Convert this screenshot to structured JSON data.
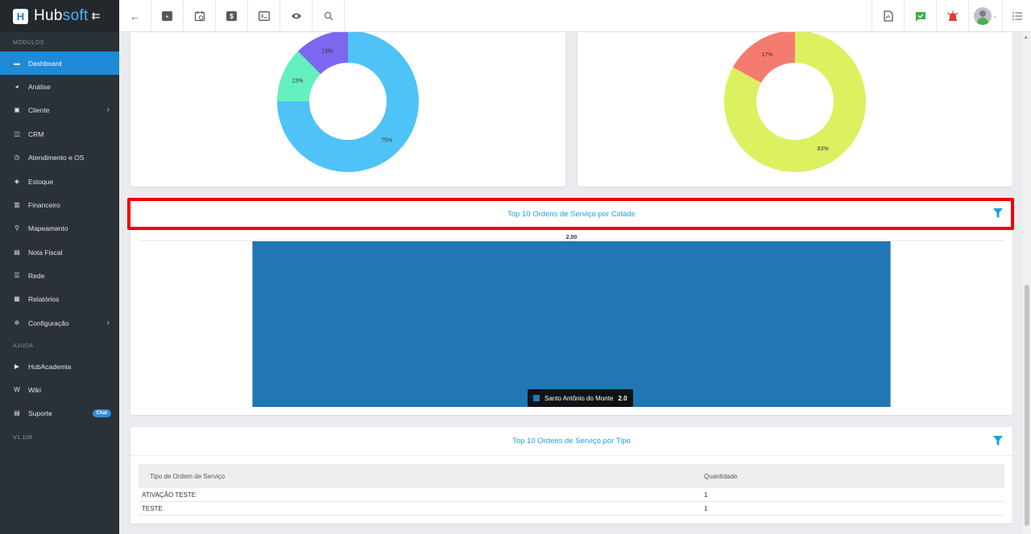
{
  "app": {
    "logo_hub": "Hub",
    "logo_soft": "soft",
    "collapse_icon": "menu-collapse-icon"
  },
  "sidebar": {
    "modules_label": "MÓDULOS",
    "help_label": "AJUDA",
    "version": "V1.108",
    "items": [
      {
        "label": "Dashboard",
        "icon": "dashboard-icon",
        "active": true
      },
      {
        "label": "Análise",
        "icon": "chart-pie-icon"
      },
      {
        "label": "Cliente",
        "icon": "contact-icon",
        "chevron": true
      },
      {
        "label": "CRM",
        "icon": "crm-icon"
      },
      {
        "label": "Atendimento e OS",
        "icon": "calendar-clock-icon"
      },
      {
        "label": "Estoque",
        "icon": "box-icon"
      },
      {
        "label": "Financeiro",
        "icon": "money-icon"
      },
      {
        "label": "Mapeamento",
        "icon": "map-pin-icon"
      },
      {
        "label": "Nota Fiscal",
        "icon": "invoice-icon"
      },
      {
        "label": "Rede",
        "icon": "server-icon"
      },
      {
        "label": "Relatórios",
        "icon": "report-icon"
      },
      {
        "label": "Configuração",
        "icon": "gear-icon",
        "chevron": true
      }
    ],
    "help_items": [
      {
        "label": "HubAcademia",
        "icon": "youtube-icon"
      },
      {
        "label": "Wiki",
        "icon": "wiki-icon"
      },
      {
        "label": "Suporte",
        "icon": "support-icon",
        "badge": "Chat"
      }
    ]
  },
  "topbar": {
    "left_icons": [
      "back-arrow-icon",
      "contact-card-icon",
      "calendar-icon",
      "dollar-icon",
      "terminal-icon",
      "eye-icon",
      "search-icon"
    ],
    "right_icons": [
      "pdf-icon",
      "chat-check-icon",
      "alarm-icon",
      "user-avatar",
      "menu-list-icon"
    ]
  },
  "donut_left": {
    "slices": [
      {
        "label": "75%",
        "value": 75,
        "color": "#4fc3f7"
      },
      {
        "label": "13%",
        "value": 12.5,
        "color": "#64f0c0"
      },
      {
        "label": "13%",
        "value": 12.5,
        "color": "#7b68ee"
      }
    ]
  },
  "donut_right": {
    "slices": [
      {
        "label": "83%",
        "value": 83,
        "color": "#dcf060"
      },
      {
        "label": "17%",
        "value": 17,
        "color": "#f57b70"
      }
    ]
  },
  "city_card": {
    "title": "Top 10 Ordens de Serviço por Cidade",
    "chart_data": {
      "type": "bar",
      "categories": [
        "Santo Antônio do Monte"
      ],
      "values": [
        2.0
      ],
      "data_label": "2.00",
      "tooltip_label": "Santo Antônio do Monte",
      "tooltip_value": "2.0",
      "color": "#2176b4"
    }
  },
  "type_card": {
    "title": "Top 10 Ordens de Serviço por Tipo",
    "columns": [
      "Tipo de Ordem de Serviço",
      "Quantidade"
    ],
    "rows": [
      {
        "tipo": "ATIVAÇÃO TESTE",
        "quantidade": "1"
      },
      {
        "tipo": "TESTE",
        "quantidade": "1"
      }
    ]
  }
}
